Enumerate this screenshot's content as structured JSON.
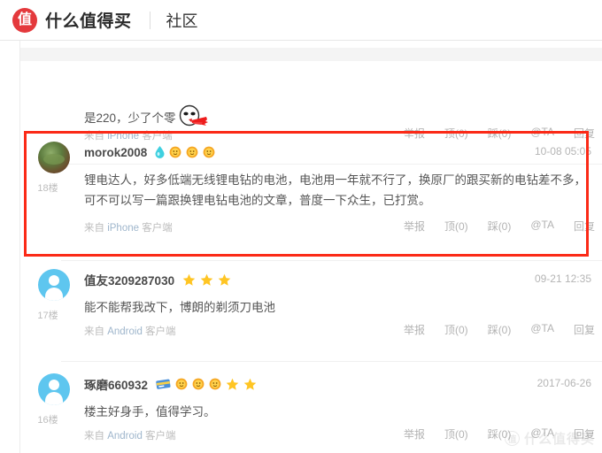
{
  "header": {
    "logo_char": "值",
    "logo_text": "什么值得买",
    "nav_item": "社区"
  },
  "actions": {
    "report": "举报",
    "up": "顶(0)",
    "down": "踩(0)",
    "at": "@TA",
    "reply": "回复"
  },
  "source": {
    "prefix": "来自",
    "iphone": "iPhone",
    "android": "Android",
    "suffix": "客户端"
  },
  "colors": {
    "highlight_border": "#fb2a17",
    "logo_red": "#e4393c",
    "badge_yellow": "#f9c01f",
    "badge_orange": "#f5a623",
    "drop_cyan": "#3fd0e0",
    "avatar_blue": "#5ec6ef"
  },
  "comments": [
    {
      "id": "comment-partial",
      "floor": "",
      "name": "",
      "time": "",
      "text": "是220，少了个零",
      "text_has_emoji": true,
      "emoji_name": "vomit-blood-face",
      "device": "iPhone",
      "badges": []
    },
    {
      "id": "comment-18",
      "floor": "18楼",
      "name": "morok2008",
      "time": "10-08 05:05",
      "text": "锂电达人，好多低端无线锂电钻的电池，电池用一年就不行了，换原厂的跟买新的电钻差不多，可不可以写一篇跟换锂电钻电池的文章，普度一下众生，已打赏。",
      "text_has_emoji": false,
      "device": "iPhone",
      "avatar_type": "photo",
      "highlighted": true,
      "badges": [
        "water-drop",
        "flower",
        "flower",
        "flower"
      ]
    },
    {
      "id": "comment-17",
      "floor": "17楼",
      "name": "值友3209287030",
      "time": "09-21 12:35",
      "text": "能不能帮我改下，博朗的剃须刀电池",
      "text_has_emoji": false,
      "device": "Android",
      "avatar_type": "default",
      "highlighted": false,
      "badges": [
        "star",
        "star",
        "star"
      ]
    },
    {
      "id": "comment-16",
      "floor": "16楼",
      "name": "琢磨660932",
      "time": "2017-06-26",
      "text": "楼主好身手，值得学习。",
      "text_has_emoji": false,
      "device": "Android",
      "avatar_type": "default",
      "highlighted": false,
      "badges": [
        "card",
        "flower",
        "flower",
        "flower",
        "star",
        "star"
      ]
    }
  ],
  "watermark": {
    "mark_char": "值",
    "text": "什么值得买"
  }
}
